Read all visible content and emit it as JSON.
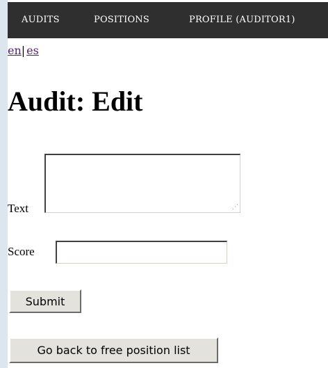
{
  "nav": {
    "items": [
      {
        "label": "AUDITS"
      },
      {
        "label": "POSITIONS"
      },
      {
        "label": "PROFILE (AUDITOR1)"
      }
    ]
  },
  "lang": {
    "en": "en",
    "separator": "|",
    "es": "es"
  },
  "page": {
    "title": "Audit: Edit"
  },
  "form": {
    "text_label": "Text",
    "text_value": "",
    "score_label": "Score",
    "score_value": "",
    "submit_label": "Submit",
    "back_label": "Go back to free position list"
  },
  "colors": {
    "nav_bg": "#2f2f2f",
    "visited_link": "#551a8b",
    "left_strip": "#dde6ef",
    "button_face": "#e4e2dc"
  }
}
